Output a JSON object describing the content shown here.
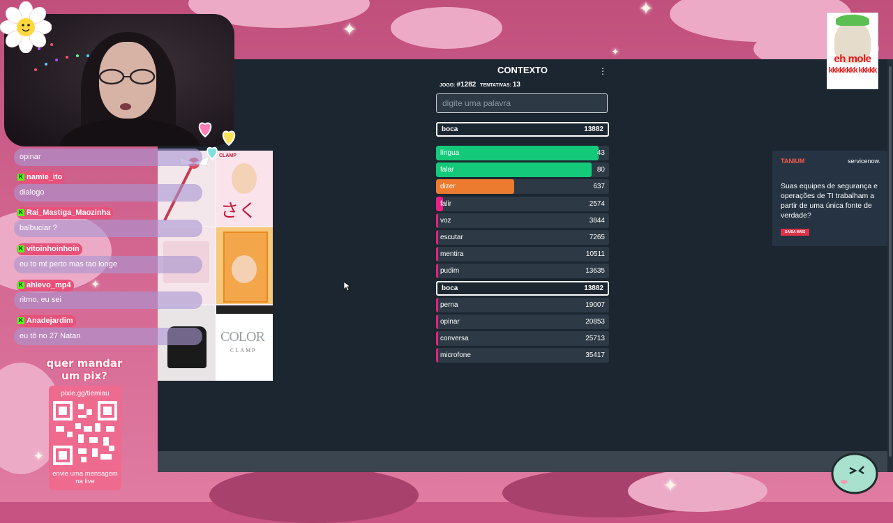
{
  "game": {
    "title": "CONTEXTO",
    "info_prefix": "JOGO:",
    "game_number": "#1282",
    "attempts_label": "TENTATIVAS:",
    "attempts": "13",
    "input_placeholder": "digite uma palavra",
    "current_guess": {
      "word": "boca",
      "score": "13882"
    },
    "guesses": [
      {
        "word": "língua",
        "score": "43",
        "fill_pct": 94,
        "color": "#14c97a"
      },
      {
        "word": "falar",
        "score": "80",
        "fill_pct": 90,
        "color": "#14c97a"
      },
      {
        "word": "dizer",
        "score": "637",
        "fill_pct": 45,
        "color": "#ec7b2f"
      },
      {
        "word": "falir",
        "score": "2574",
        "fill_pct": 4,
        "color": "#e91e86"
      },
      {
        "word": "voz",
        "score": "3844",
        "fill_pct": 1,
        "color": "#e91e86"
      },
      {
        "word": "escutar",
        "score": "7265",
        "fill_pct": 1,
        "color": "#e91e86"
      },
      {
        "word": "mentira",
        "score": "10511",
        "fill_pct": 1,
        "color": "#e91e86"
      },
      {
        "word": "pudim",
        "score": "13635",
        "fill_pct": 1,
        "color": "#e91e86"
      },
      {
        "word": "boca",
        "score": "13882",
        "fill_pct": 0,
        "color": "#e91e86",
        "current": true
      },
      {
        "word": "perna",
        "score": "19007",
        "fill_pct": 1,
        "color": "#e91e86"
      },
      {
        "word": "opinar",
        "score": "20853",
        "fill_pct": 1,
        "color": "#e91e86"
      },
      {
        "word": "conversa",
        "score": "25713",
        "fill_pct": 1,
        "color": "#e91e86"
      },
      {
        "word": "microfone",
        "score": "35417",
        "fill_pct": 1,
        "color": "#e91e86"
      }
    ]
  },
  "ad": {
    "brand1": "TANIUM",
    "brand2": "servicenow.",
    "text": "Suas equipes de segurança e operações de TI trabalham a partir de uma única fonte de verdade?",
    "button": "SAIBA MAIS"
  },
  "chat": [
    {
      "user": "",
      "message": "opinar"
    },
    {
      "user": "namie_ito",
      "message": "dialogo"
    },
    {
      "user": "Rai_Mastiga_Maozinha",
      "message": "balbuciar ?"
    },
    {
      "user": "vitoinhoinhoin",
      "message": "eu to mt perto mas tao longe"
    },
    {
      "user": "ahlevo_mp4",
      "message": "ritmo, eu sei"
    },
    {
      "user": "Anadejardim",
      "message": "eu tô no 27 Natan"
    }
  ],
  "pix": {
    "title": "quer mandar um pix?",
    "url": "pixie.gg/tiemiau",
    "note": "envie uma mensagem na live"
  },
  "meme": {
    "line1": "eh mole",
    "line2": "kkkkkkkk kkkkk"
  },
  "collage": {
    "tile2_brand": "CLAMP",
    "tile2_title": "さくら",
    "tile6_title": "COLOR",
    "tile6_sub": "CLAMP"
  }
}
